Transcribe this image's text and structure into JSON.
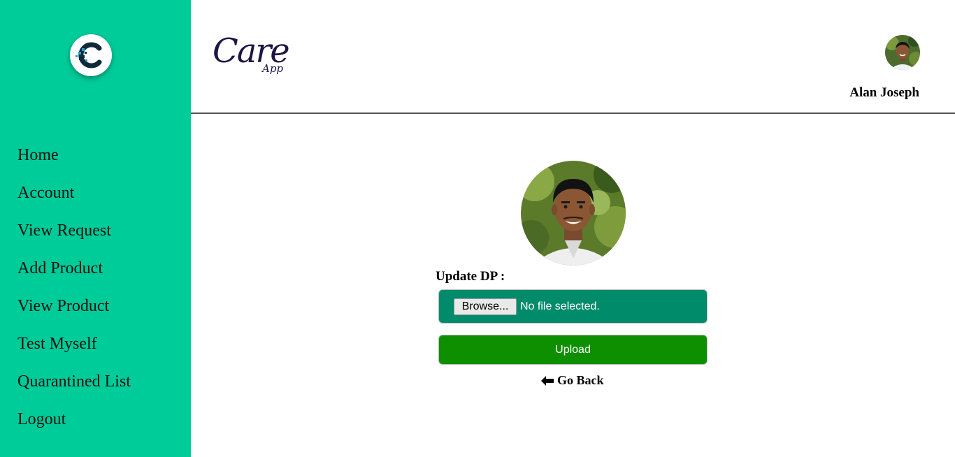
{
  "sidebar": {
    "logo_icon": "care-app-c-logo-icon",
    "items": [
      {
        "label": "Home"
      },
      {
        "label": "Account"
      },
      {
        "label": "View Request"
      },
      {
        "label": "Add Product"
      },
      {
        "label": "View Product"
      },
      {
        "label": "Test Myself"
      },
      {
        "label": "Quarantined List"
      },
      {
        "label": "Logout"
      }
    ],
    "background_color": "#00cc99"
  },
  "header": {
    "brand_main": "Care",
    "brand_sub": "App",
    "user_name": "Alan Joseph",
    "avatar_icon": "user-avatar"
  },
  "main": {
    "update_label": "Update DP :",
    "browse_label": "Browse...",
    "file_status": "No file selected.",
    "upload_label": "Upload",
    "go_back_label": "Go Back",
    "go_back_icon": "arrow-left-icon",
    "file_box_color": "#008b6b",
    "upload_color": "#0e8f00"
  }
}
